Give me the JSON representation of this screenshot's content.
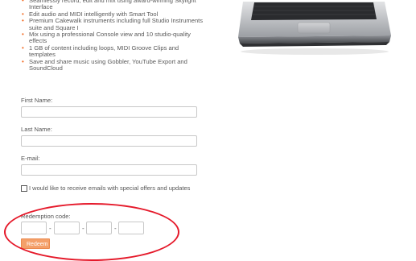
{
  "features": [
    "Seamlessly record, edit and mix using award-winning Skylight Interface",
    "Edit audio and MIDI intelligently with Smart Tool",
    "Premium Cakewalk instruments including full Studio Instruments suite and Square I",
    "Mix using a professional Console view and 10 studio-quality effects",
    "1 GB of content including loops, MIDI Groove Clips and templates",
    "Save and share music using Gobbler, YouTube Export and SoundCloud"
  ],
  "form": {
    "first_name_label": "First Name:",
    "first_name_value": "",
    "last_name_label": "Last Name:",
    "last_name_value": "",
    "email_label": "E-mail:",
    "email_value": "",
    "newsletter_label": "I would like to receive emails with special offers and updates",
    "newsletter_checked": false
  },
  "redemption": {
    "label": "Redemption code:",
    "separator": "-",
    "codes": [
      "",
      "",
      "",
      ""
    ],
    "button_label": "Redeem"
  },
  "colors": {
    "accent": "#f26a21",
    "button": "#f4a06a",
    "highlight_ellipse": "#e5192a"
  },
  "images": {
    "product": "laptop-photo"
  }
}
